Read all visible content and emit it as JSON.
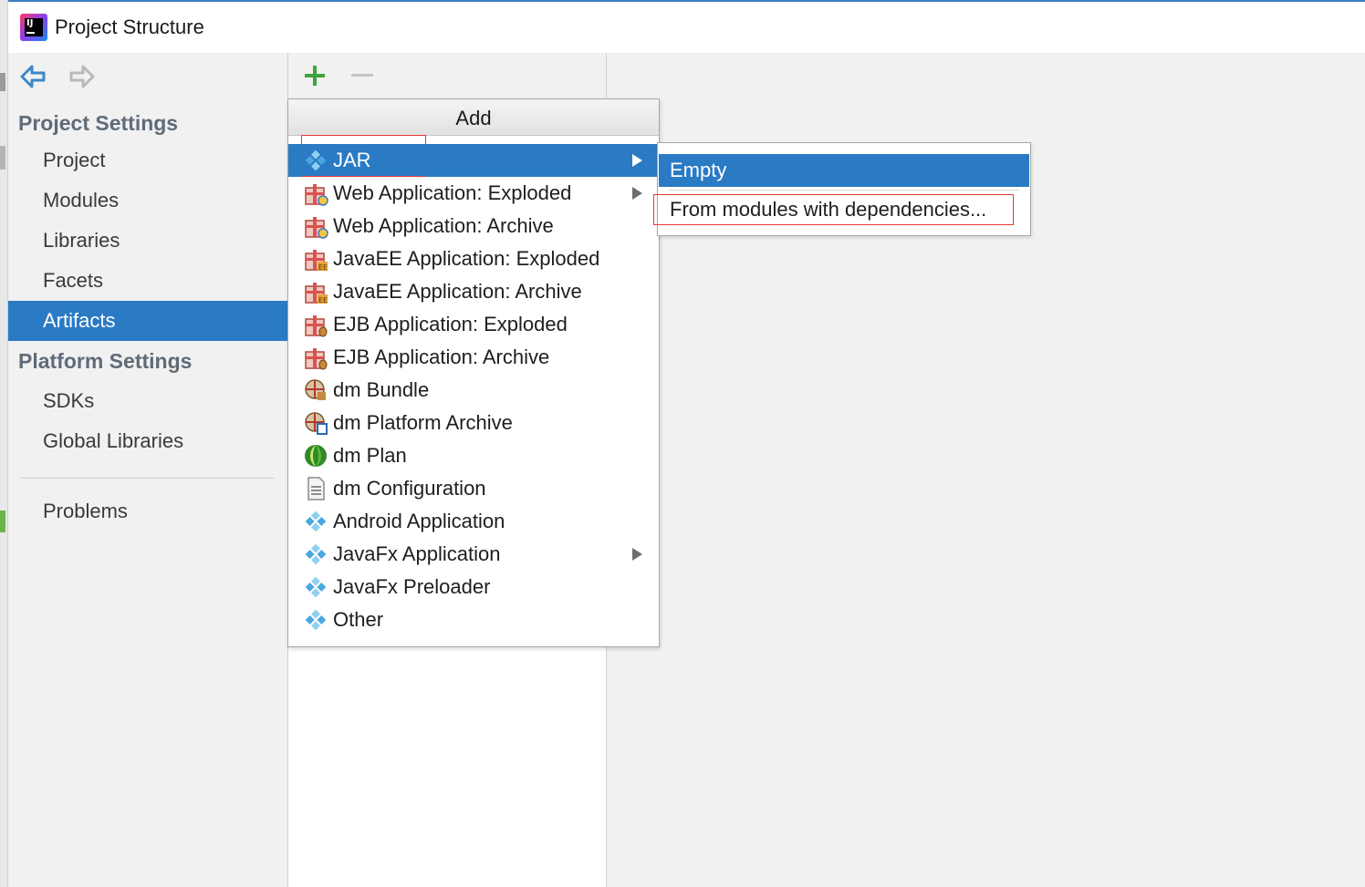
{
  "window": {
    "title": "Project Structure"
  },
  "sidebar": {
    "project_settings_title": "Project Settings",
    "project_items": [
      {
        "label": "Project"
      },
      {
        "label": "Modules"
      },
      {
        "label": "Libraries"
      },
      {
        "label": "Facets"
      },
      {
        "label": "Artifacts",
        "selected": true
      }
    ],
    "platform_settings_title": "Platform Settings",
    "platform_items": [
      {
        "label": "SDKs"
      },
      {
        "label": "Global Libraries"
      }
    ],
    "problems_label": "Problems"
  },
  "popup": {
    "header": "Add",
    "items": [
      {
        "label": "JAR",
        "icon": "artifact-diamond-icon",
        "selected": true,
        "has_submenu": true
      },
      {
        "label": "Web Application: Exploded",
        "icon": "web-app-gift-icon",
        "has_submenu": true
      },
      {
        "label": "Web Application: Archive",
        "icon": "web-app-gift-icon"
      },
      {
        "label": "JavaEE Application: Exploded",
        "icon": "javaee-gift-icon"
      },
      {
        "label": "JavaEE Application: Archive",
        "icon": "javaee-gift-icon"
      },
      {
        "label": "EJB Application: Exploded",
        "icon": "ejb-gift-icon"
      },
      {
        "label": "EJB Application: Archive",
        "icon": "ejb-gift-icon"
      },
      {
        "label": "dm Bundle",
        "icon": "dm-bundle-icon"
      },
      {
        "label": "dm Platform Archive",
        "icon": "dm-platform-icon"
      },
      {
        "label": "dm Plan",
        "icon": "dm-plan-icon"
      },
      {
        "label": "dm Configuration",
        "icon": "document-icon"
      },
      {
        "label": "Android Application",
        "icon": "artifact-diamond-icon"
      },
      {
        "label": "JavaFx Application",
        "icon": "artifact-diamond-icon",
        "has_submenu": true
      },
      {
        "label": "JavaFx Preloader",
        "icon": "artifact-diamond-icon"
      },
      {
        "label": "Other",
        "icon": "artifact-diamond-icon"
      }
    ]
  },
  "submenu": {
    "empty_label": "Empty",
    "from_modules_label": "From modules with dependencies..."
  },
  "colors": {
    "selection": "#2a7ac4",
    "highlight_box": "#e53935",
    "add_green": "#3aa53a",
    "panel_bg": "#f1f1f1"
  }
}
